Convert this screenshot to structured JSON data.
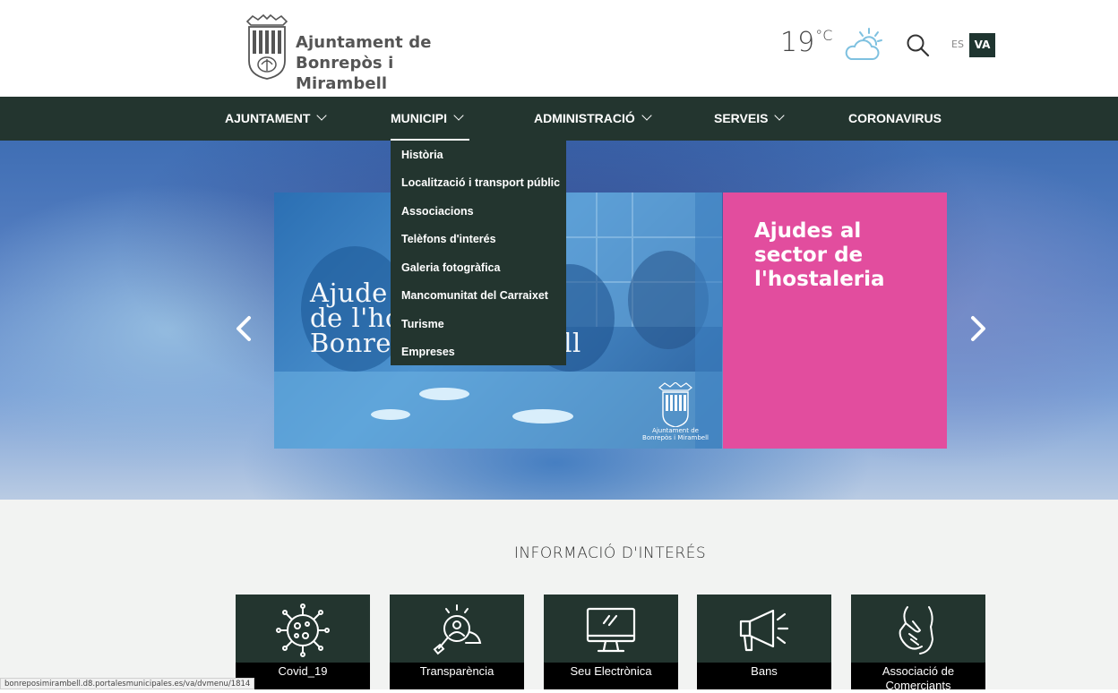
{
  "header": {
    "logo_line1": "Ajuntament de",
    "logo_line2": "Bonrepòs i Mirambell",
    "temperature": "19",
    "temperature_unit": "°C",
    "weather_icon": "partly-cloudy-icon",
    "search_icon": "search-icon",
    "lang_es": "ES",
    "lang_va": "VA",
    "active_lang": "VA"
  },
  "nav": {
    "items": [
      {
        "label": "AJUNTAMENT",
        "has_dropdown": true
      },
      {
        "label": "MUNICIPI",
        "has_dropdown": true
      },
      {
        "label": "ADMINISTRACIÓ",
        "has_dropdown": true
      },
      {
        "label": "SERVEIS",
        "has_dropdown": true
      },
      {
        "label": "CORONAVIRUS",
        "has_dropdown": false
      }
    ],
    "active": "MUNICIPI"
  },
  "dropdown": {
    "items": [
      "Història",
      "Localització i transport públic",
      "Associacions",
      "Telèfons d'interés",
      "Galeria fotogràfica",
      "Mancomunitat del Carraixet",
      "Turisme",
      "Empreses"
    ]
  },
  "slider": {
    "pink_title": "Ajudes al sector de l'hostaleria",
    "photo_text_line1": "Ajude",
    "photo_text_line2": "de l'ho",
    "photo_text_line3": "Bonre                bell",
    "crest_caption_line1": "Ajuntament de",
    "crest_caption_line2": "Bonrepòs i Mirambell",
    "prev_icon": "chevron-left-icon",
    "next_icon": "chevron-right-icon",
    "accent_color": "#e24d9e"
  },
  "info": {
    "title": "INFORMACIÓ D'INTERÉS",
    "cards": [
      {
        "label": "Covid_19",
        "icon": "virus-icon"
      },
      {
        "label": "Transparència",
        "icon": "magnifier-person-icon"
      },
      {
        "label": "Seu Electrònica",
        "icon": "monitor-icon"
      },
      {
        "label": "Bans",
        "icon": "megaphone-icon"
      },
      {
        "label": "Associació de Comerciants",
        "icon": "handshake-icon"
      }
    ]
  },
  "status_bar": {
    "url": "bonreposimirambell.d8.portalesmunicipales.es/va/dvmenu/1814"
  },
  "colors": {
    "dark_green": "#23352f",
    "pink": "#e24d9e"
  }
}
